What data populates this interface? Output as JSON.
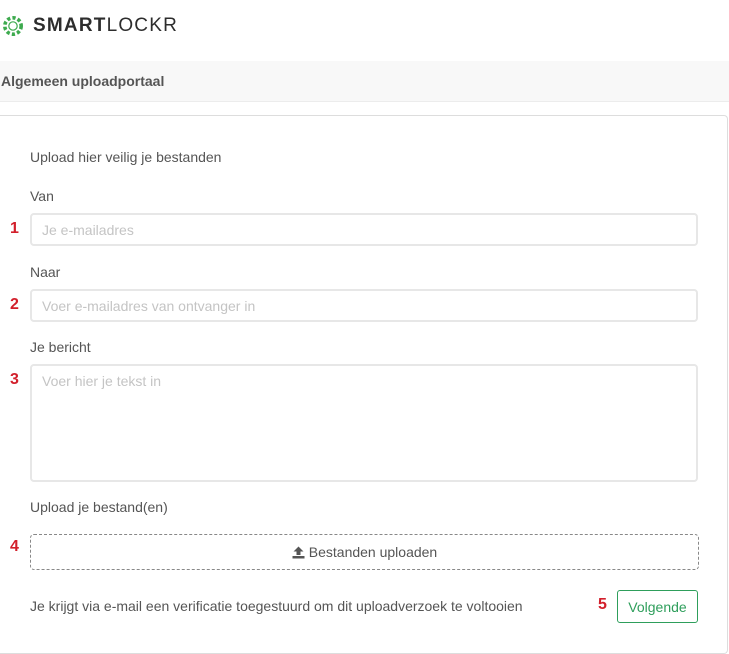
{
  "brand": {
    "logo_bold": "SMART",
    "logo_light": "LOCKR",
    "logo_color": "#3daa4e"
  },
  "header": {
    "title": "Algemeen uploadportaal"
  },
  "form": {
    "intro": "Upload hier veilig je bestanden",
    "from_label": "Van",
    "from_placeholder": "Je e-mailadres",
    "from_value": "",
    "to_label": "Naar",
    "to_placeholder": "Voer e-mailadres van ontvanger in",
    "to_value": "",
    "message_label": "Je bericht",
    "message_placeholder": "Voer hier je tekst in",
    "message_value": "",
    "upload_label": "Upload je bestand(en)",
    "upload_button_label": "Bestanden uploaden",
    "upload_icon": "upload-icon",
    "verification_note": "Je krijgt via e-mail een verificatie toegestuurd om dit uploadverzoek te voltooien",
    "next_button_label": "Volgende",
    "accent_color": "#2e9e5b"
  },
  "annotations": {
    "marker_1": "1",
    "marker_2": "2",
    "marker_3": "3",
    "marker_4": "4",
    "marker_5": "5",
    "color": "#d21f2b"
  }
}
